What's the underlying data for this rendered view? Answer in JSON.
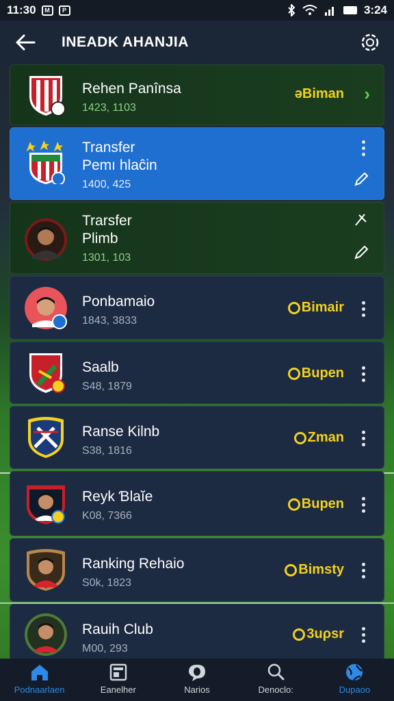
{
  "status_bar": {
    "time_left": "11:30",
    "time_right": "3:24",
    "icons": [
      "m-icon",
      "p-icon",
      "bluetooth-icon",
      "wifi-icon",
      "signal-icon",
      "battery-icon"
    ]
  },
  "app_bar": {
    "title": "INEADK AHANJIA"
  },
  "rows": [
    {
      "name": "Rehen Panînsa",
      "name2": "",
      "sub": "1423, 1103",
      "badge": "ǝBiman",
      "theme": "green",
      "action": "chevron"
    },
    {
      "name": "Transfer",
      "name2": "Pemı hlaĉin",
      "sub": "1400, 425",
      "badge": "",
      "theme": "blue",
      "action": "more-edit"
    },
    {
      "name": "Trarsfer",
      "name2": "Plimb",
      "sub": "1301, 103",
      "badge": "",
      "theme": "green",
      "action": "edit"
    },
    {
      "name": "Ponbamaio",
      "name2": "",
      "sub": "1843, 3833",
      "badge": "Bimair",
      "theme": "navy",
      "action": "more"
    },
    {
      "name": "Saalb",
      "name2": "",
      "sub": "S48, 1879",
      "badge": "Bupen",
      "theme": "navy",
      "action": "more"
    },
    {
      "name": "Ranse Kilnb",
      "name2": "",
      "sub": "S38, 1816",
      "badge": "Zman",
      "theme": "navy",
      "action": "more"
    },
    {
      "name": "Reyk Ɓlaĭe",
      "name2": "",
      "sub": "K08, 7366",
      "badge": "Bupen",
      "theme": "navy",
      "action": "more"
    },
    {
      "name": "Ranking Rehaio",
      "name2": "",
      "sub": "S0k, 1823",
      "badge": "Bimsty",
      "theme": "navy",
      "action": "more"
    },
    {
      "name": "Rauih Club",
      "name2": "",
      "sub": "M00, 293",
      "badge": "3uρsr",
      "theme": "navy",
      "action": "more"
    }
  ],
  "nav": [
    {
      "label": "Podnaarlaen",
      "icon": "home-icon",
      "active": true
    },
    {
      "label": "Eanelher",
      "icon": "tablet-icon",
      "active": false
    },
    {
      "label": "Narios",
      "icon": "chat-icon",
      "active": false
    },
    {
      "label": "Denoclo:",
      "icon": "search-icon",
      "active": false
    },
    {
      "label": "Dupaoo",
      "icon": "globe-icon",
      "active": false
    }
  ],
  "colors": {
    "accent": "#2d8ae8",
    "badge": "#f3d21e",
    "row_blue": "#1f6fd0",
    "row_navy": "#1c2a42",
    "row_green": "#15351b"
  }
}
